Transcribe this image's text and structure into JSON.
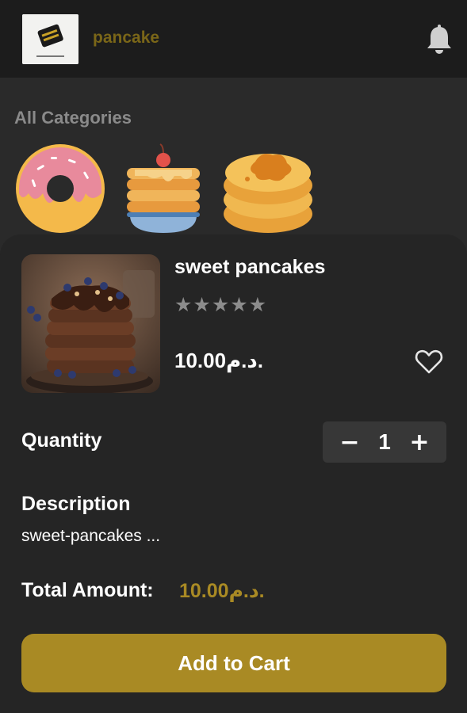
{
  "header": {
    "app_title": "pancake",
    "logo_icon": "pancake-logo",
    "notification_icon": "bell-icon"
  },
  "categories": {
    "title": "All Categories",
    "items": [
      {
        "icon": "donut-icon"
      },
      {
        "icon": "pancake-stack-icon"
      },
      {
        "icon": "pancake-pile-icon"
      }
    ]
  },
  "product": {
    "name": "sweet pancakes",
    "rating_stars": "★★★★★",
    "rating_value": 0,
    "price": "10.00د.م.",
    "favorite_icon": "heart-icon"
  },
  "quantity": {
    "label": "Quantity",
    "minus": "−",
    "value": "1",
    "plus": "+"
  },
  "description": {
    "label": "Description",
    "text": "sweet-pancakes ..."
  },
  "total": {
    "label": "Total Amount:",
    "value": "10.00د.م."
  },
  "cta": {
    "label": "Add to Cart"
  },
  "colors": {
    "accent": "#a98a24",
    "header_bg": "#1c1c1c",
    "page_bg": "#2a2a2a",
    "sheet_bg": "#252525"
  }
}
